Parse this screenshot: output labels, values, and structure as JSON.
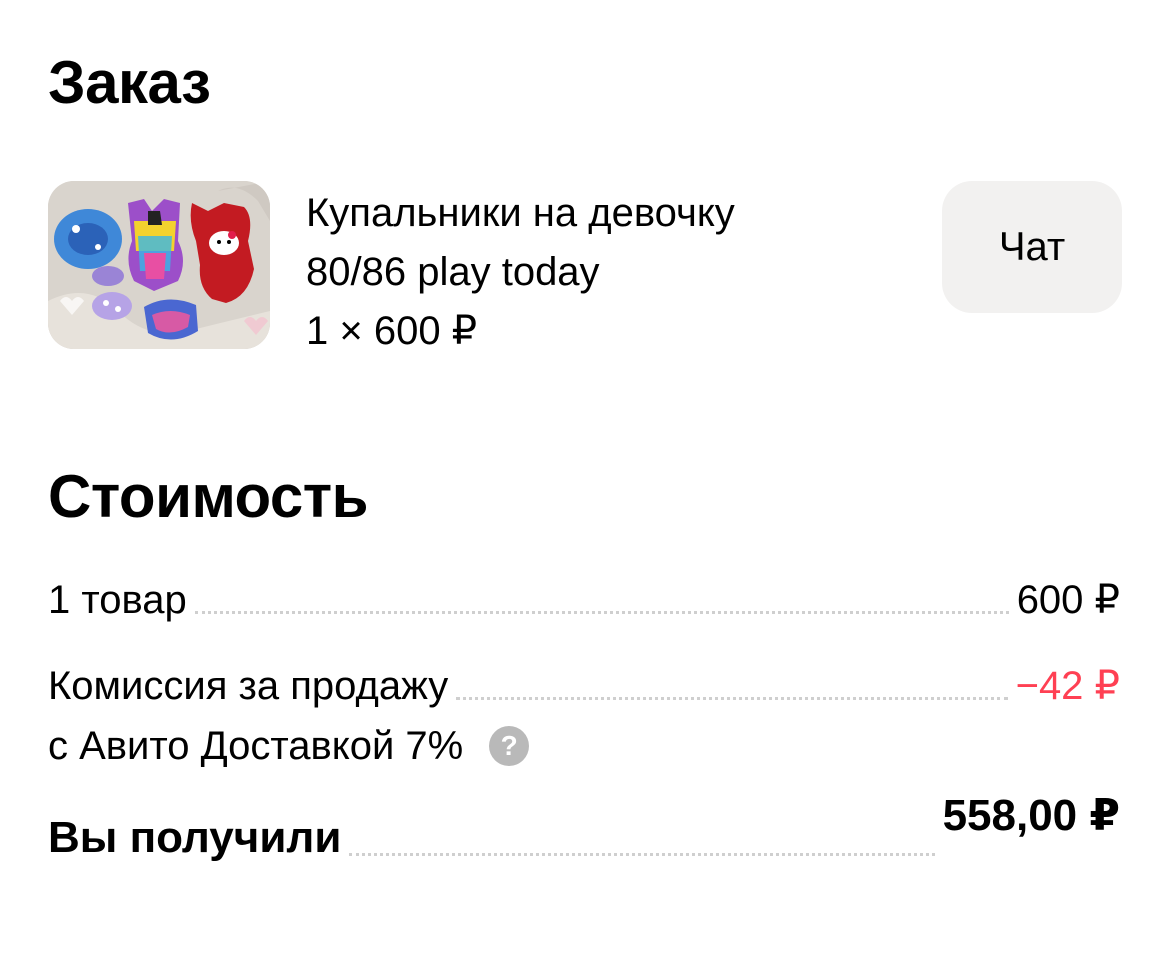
{
  "order": {
    "title": "Заказ",
    "product": {
      "name_line1": "Купальники на девочку",
      "name_line2": "80/86 play today",
      "quantity_price": "1 × 600 ₽",
      "image_icon": "swimsuits-photo"
    },
    "chat_button": "Чат"
  },
  "cost": {
    "title": "Стоимость",
    "items_label": "1 товар",
    "items_value": "600 ₽",
    "commission_label_line1": "Комиссия за продажу",
    "commission_label_line2": "с Авито Доставкой 7%",
    "commission_value": "−42 ₽",
    "help_icon": "question-circle-icon",
    "total_label": "Вы получили",
    "total_value": "558,00 ₽"
  },
  "colors": {
    "negative": "#ff4053",
    "button_bg": "#f2f1f0",
    "help_icon": "#b9b9b9"
  }
}
